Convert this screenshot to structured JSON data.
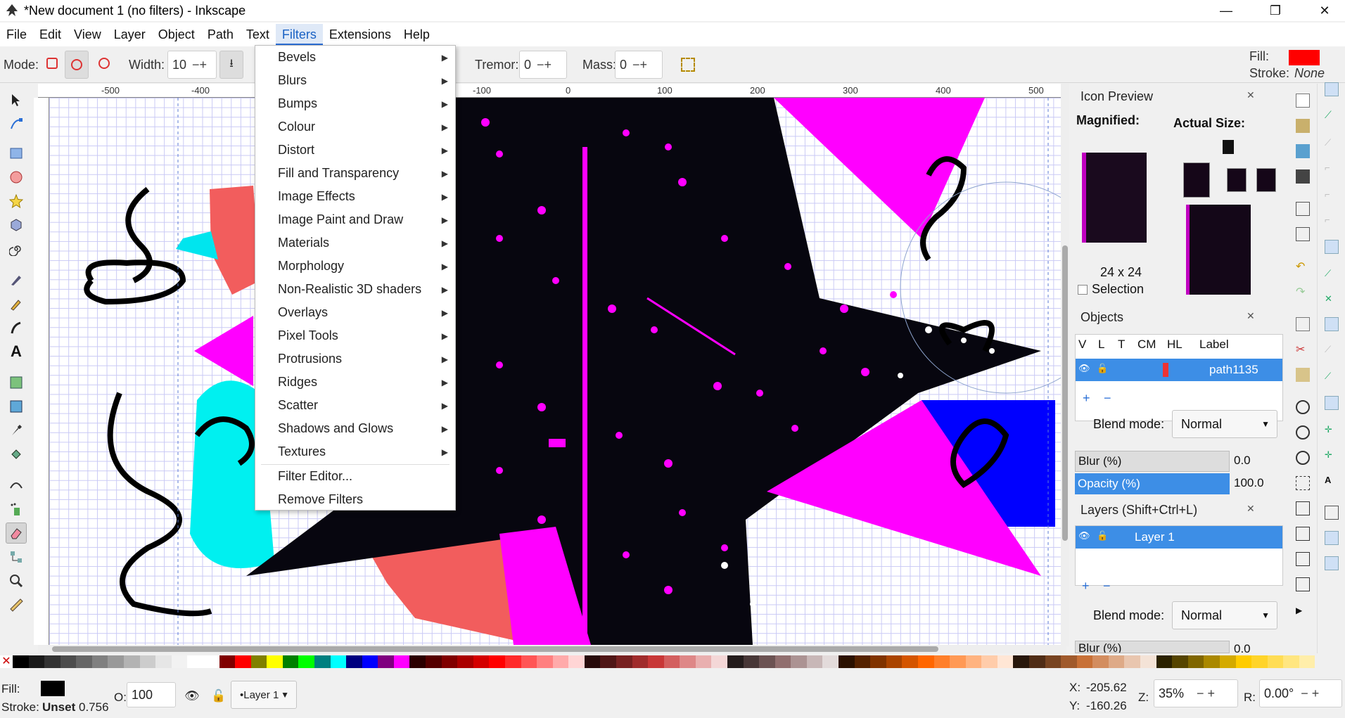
{
  "window": {
    "title": "*New document 1 (no filters) - Inkscape",
    "minimize": "—",
    "restore": "❐",
    "close": "✕"
  },
  "menu": [
    "File",
    "Edit",
    "View",
    "Layer",
    "Object",
    "Path",
    "Text",
    "Filters",
    "Extensions",
    "Help"
  ],
  "toolctl": {
    "mode_label": "Mode:",
    "width_label": "Width:",
    "width_value": "10",
    "tremor_label": "Tremor:",
    "tremor_value": "0",
    "mass_label": "Mass:",
    "mass_value": "0",
    "fill_label": "Fill:",
    "stroke_label": "Stroke:",
    "stroke_value": "None",
    "fill_color": "#ff0000"
  },
  "filters_menu": {
    "items": [
      "Bevels",
      "Blurs",
      "Bumps",
      "Colour",
      "Distort",
      "Fill and Transparency",
      "Image Effects",
      "Image Paint and Draw",
      "Materials",
      "Morphology",
      "Non-Realistic 3D shaders",
      "Overlays",
      "Pixel Tools",
      "Protrusions",
      "Ridges",
      "Scatter",
      "Shadows and Glows",
      "Textures"
    ],
    "editor": "Filter Editor...",
    "remove": "Remove Filters"
  },
  "ruler": {
    "h": [
      "-500",
      "-400",
      "-100",
      "0",
      "100",
      "200",
      "300",
      "400",
      "500"
    ]
  },
  "icon_preview": {
    "title": "Icon Preview",
    "magnified": "Magnified:",
    "actual_size": "Actual Size:",
    "size": "24 x 24",
    "selection": "Selection"
  },
  "objects": {
    "title": "Objects",
    "cols": [
      "V",
      "L",
      "T",
      "CM",
      "HL",
      "Label"
    ],
    "row_label": "path1135",
    "blend_label": "Blend mode:",
    "blend_value": "Normal",
    "blur_label": "Blur (%)",
    "blur_value": "0.0",
    "opacity_label": "Opacity (%)",
    "opacity_value": "100.0"
  },
  "layers": {
    "title": "Layers (Shift+Ctrl+L)",
    "row_label": "Layer 1",
    "blend_label": "Blend mode:",
    "blend_value": "Normal",
    "blur_label": "Blur (%)",
    "blur_value": "0.0"
  },
  "status": {
    "fill_label": "Fill:",
    "stroke_label": "Stroke:",
    "stroke_value": "Unset",
    "stroke_width": "0.756",
    "opacity_label": "O:",
    "opacity_value": "100",
    "layer_label": "•Layer 1",
    "x_label": "X:",
    "x_value": "-205.62",
    "y_label": "Y:",
    "y_value": "-160.26",
    "z_label": "Z:",
    "zoom_value": "35%",
    "r_label": "R:",
    "rotation_value": "0.00°"
  },
  "colors": {
    "accent": "#3d8ee6",
    "magenta": "#ff00ff",
    "cyan": "#00ffff",
    "salmon": "#f25d5d",
    "blue": "#0000ff"
  },
  "palette": [
    "#000000",
    "#1a1a1a",
    "#333333",
    "#4d4d4d",
    "#666666",
    "#808080",
    "#999999",
    "#b3b3b3",
    "#cccccc",
    "#e6e6e6",
    "#f2f2f2",
    "#ffffff",
    "#ffffff",
    "#800000",
    "#ff0000",
    "#808000",
    "#ffff00",
    "#008000",
    "#00ff00",
    "#008080",
    "#00ffff",
    "#000080",
    "#0000ff",
    "#800080",
    "#ff00ff",
    "#2b0000",
    "#550000",
    "#800000",
    "#aa0000",
    "#d40000",
    "#ff0000",
    "#ff2a2a",
    "#ff5555",
    "#ff8080",
    "#ffaaaa",
    "#ffd5d5",
    "#280b0b",
    "#501616",
    "#782121",
    "#a02c2c",
    "#c83737",
    "#d35f5f",
    "#de8787",
    "#e9afaf",
    "#f4d7d7",
    "#241c1c",
    "#483737",
    "#6c5353",
    "#916f6f",
    "#ac9393",
    "#c8b7b7",
    "#e3dbdb",
    "#2b1100",
    "#552200",
    "#803300",
    "#aa4400",
    "#d45500",
    "#ff6600",
    "#ff7f2a",
    "#ff9955",
    "#ffb380",
    "#ffccaa",
    "#ffe6d5",
    "#28170b",
    "#502d16",
    "#784421",
    "#a05a2c",
    "#c87137",
    "#d38d5f",
    "#deaa87",
    "#e9c6af",
    "#f4e3d7",
    "#2b2200",
    "#554400",
    "#806600",
    "#aa8800",
    "#d4aa00",
    "#ffcc00",
    "#ffd42a",
    "#ffdd55",
    "#ffe680",
    "#ffeeaa"
  ]
}
